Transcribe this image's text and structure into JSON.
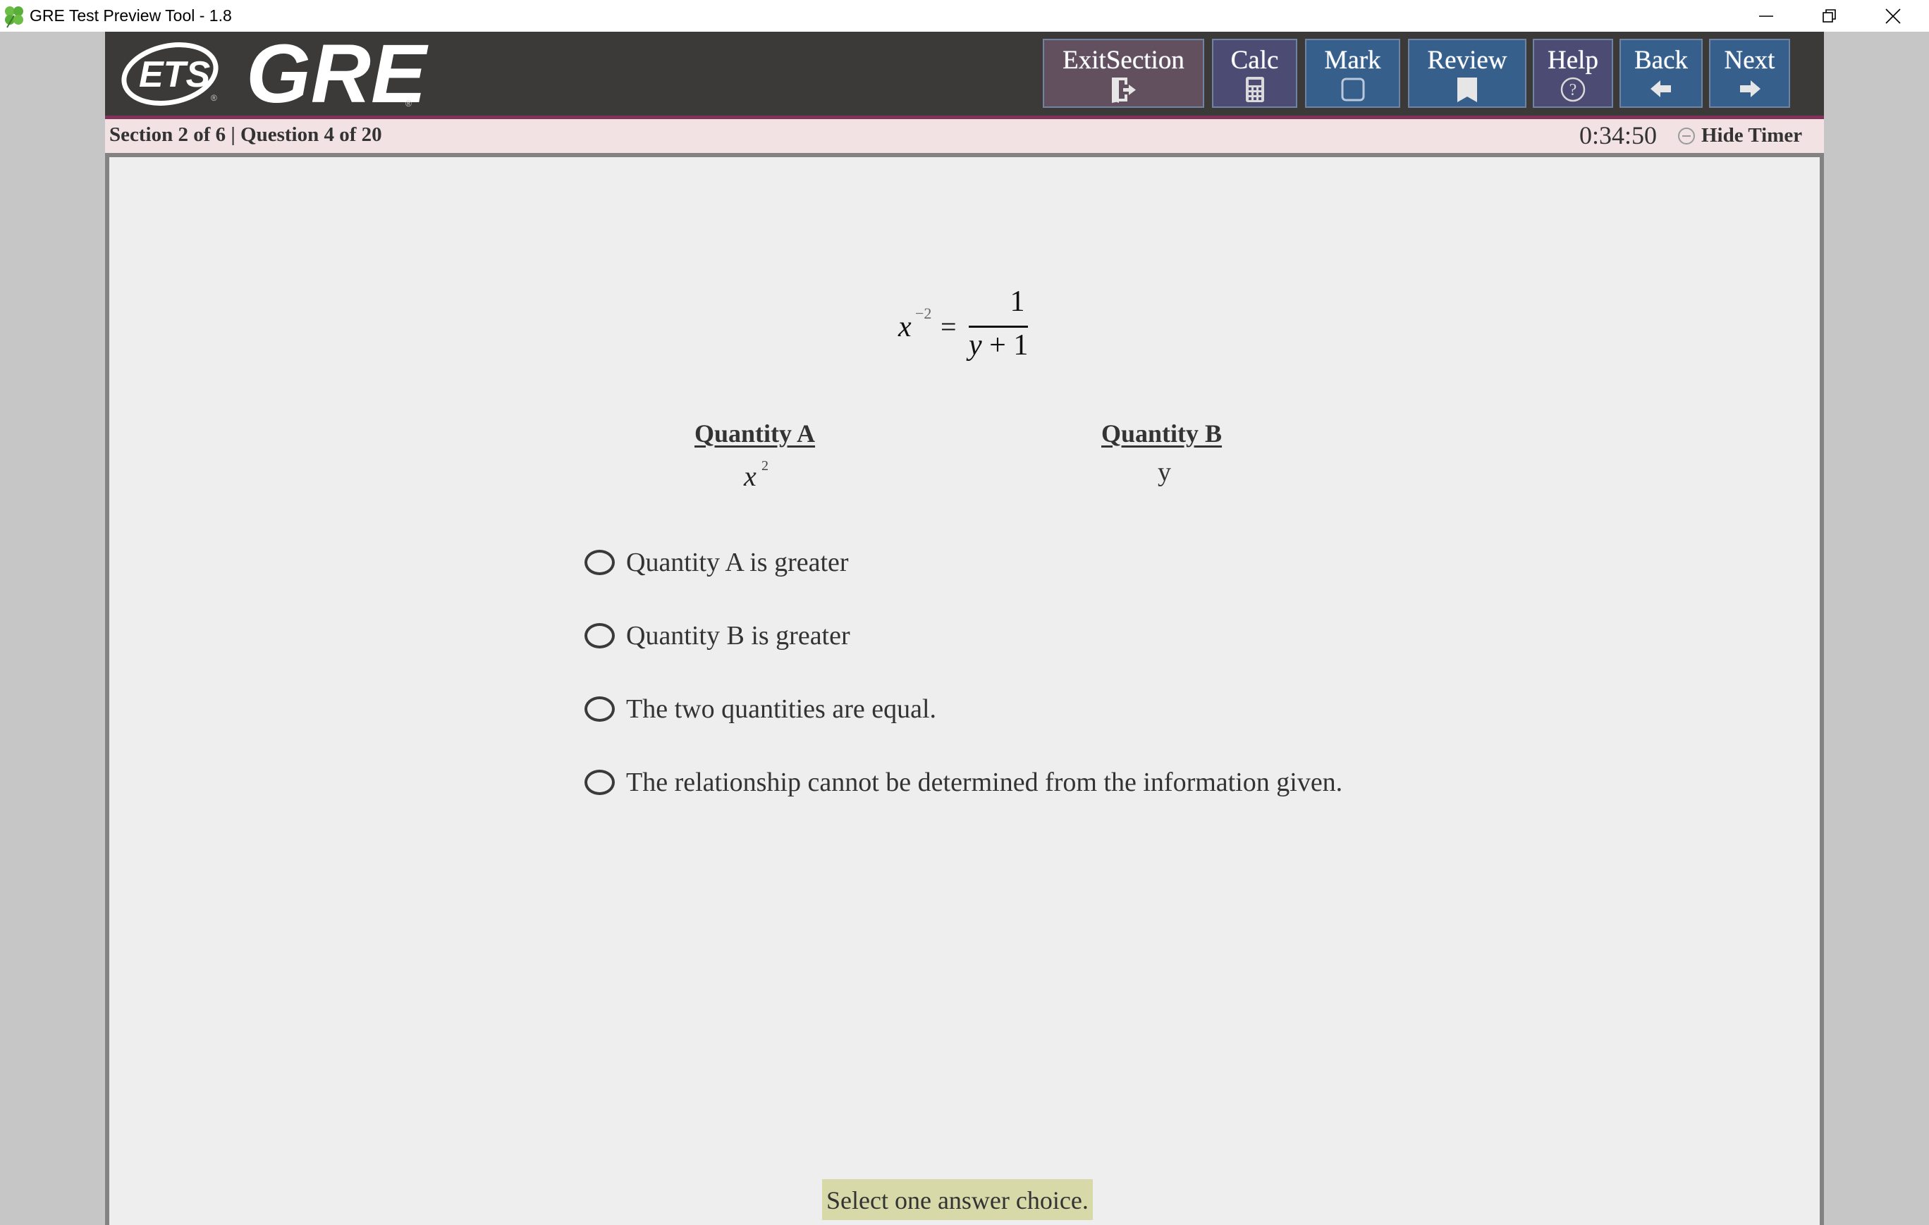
{
  "window": {
    "title": "GRE Test Preview Tool - 1.8",
    "app_icon": "four-leaf-clover-icon",
    "controls": [
      "minimize",
      "restore",
      "close"
    ]
  },
  "header": {
    "logos": [
      "ETS",
      "GRE"
    ],
    "buttons": [
      {
        "id": "exit-section",
        "label": "ExitSection",
        "icon": "exit-door-icon",
        "color": "#62505f"
      },
      {
        "id": "calc",
        "label": "Calc",
        "icon": "calculator-icon",
        "color": "#4c4b73"
      },
      {
        "id": "mark",
        "label": "Mark",
        "icon": "checkbox-icon",
        "color": "#365f8c"
      },
      {
        "id": "review",
        "label": "Review",
        "icon": "bookmark-icon",
        "color": "#365f8c"
      },
      {
        "id": "help",
        "label": "Help",
        "icon": "question-circle-icon",
        "color": "#4c4b73"
      },
      {
        "id": "back",
        "label": "Back",
        "icon": "arrow-left-icon",
        "color": "#365f8c"
      },
      {
        "id": "next",
        "label": "Next",
        "icon": "arrow-right-icon",
        "color": "#365f8c"
      }
    ],
    "accent_stripe_color": "#83325a"
  },
  "status": {
    "section_info": "Section 2 of 6 | Question 4 of 20",
    "timer": "0:34:50",
    "hide_timer_label": "Hide Timer"
  },
  "question": {
    "equation": {
      "lhs_base": "x",
      "lhs_exponent": "−2",
      "equals": "=",
      "numerator": "1",
      "denominator_var": "y",
      "denominator_rest": " + 1"
    },
    "quantity_a": {
      "heading": "Quantity A",
      "base": "x",
      "exponent": "2"
    },
    "quantity_b": {
      "heading": "Quantity B",
      "value": "y"
    },
    "choices": [
      {
        "label": "Quantity A is greater",
        "selected": false
      },
      {
        "label": "Quantity B is greater",
        "selected": false
      },
      {
        "label": "The two quantities are equal.",
        "selected": false
      },
      {
        "label": "The relationship cannot be determined from the information given.",
        "selected": false
      }
    ],
    "instruction": "Select one answer choice."
  }
}
